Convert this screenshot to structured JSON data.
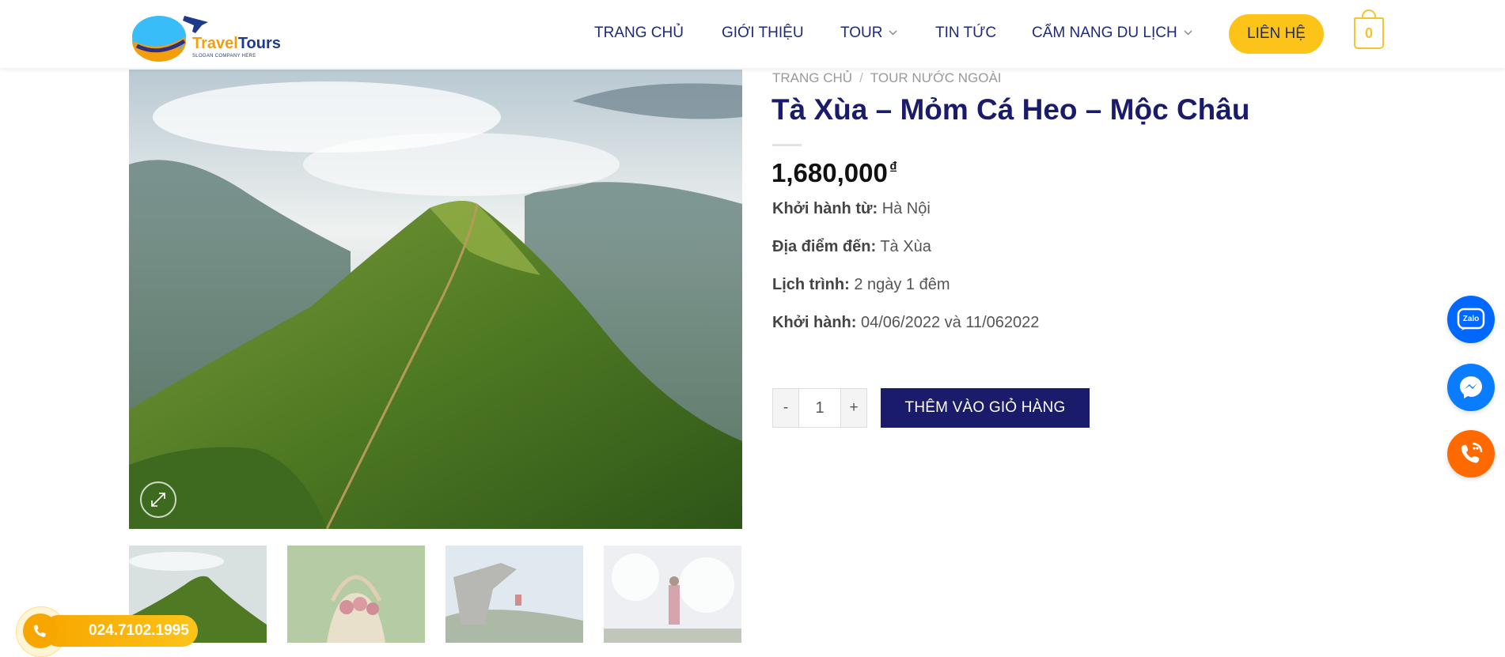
{
  "logo": {
    "name_part1": "Travel",
    "name_part2": "Tours",
    "slogan": "SLOGAN COMPANY HERE"
  },
  "nav": {
    "items": [
      {
        "label": "TRANG CHỦ",
        "dropdown": false
      },
      {
        "label": "GIỚI THIỆU",
        "dropdown": false
      },
      {
        "label": "TOUR",
        "dropdown": true
      },
      {
        "label": "TIN TỨC",
        "dropdown": false
      },
      {
        "label": "CẨM NANG DU LỊCH",
        "dropdown": true
      }
    ],
    "contact_label": "LIÊN HỆ",
    "cart_count": "0"
  },
  "breadcrumb": {
    "home": "TRANG CHỦ",
    "separator": "/",
    "category": "TOUR NƯỚC NGOÀI"
  },
  "product": {
    "title": "Tà Xùa – Mỏm Cá Heo – Mộc Châu",
    "price": "1,680,000",
    "currency": "₫",
    "details": [
      {
        "label": "Khởi hành từ:",
        "value": "Hà Nội"
      },
      {
        "label": "Địa điểm đến:",
        "value": "Tà Xùa"
      },
      {
        "label": "Lịch trình:",
        "value": "2 ngày 1 đêm"
      },
      {
        "label": "Khởi hành:",
        "value": "04/06/2022 và 11/062022"
      }
    ],
    "quantity": "1",
    "qty_minus": "-",
    "qty_plus": "+",
    "add_to_cart_label": "THÊM VÀO GIỎ HÀNG"
  },
  "floating": {
    "zalo_label": "Zalo",
    "hotline": "024.7102.1995"
  },
  "icons": {
    "zoom": "expand-icon",
    "zalo": "zalo-icon",
    "messenger": "messenger-icon",
    "phone": "phone-icon",
    "cart": "cart-icon",
    "chevron": "chevron-down-icon"
  },
  "colors": {
    "primary": "#1b1b6b",
    "accent": "#fcc419",
    "zalo": "#0068ff",
    "messenger": "#0a7cff",
    "phone": "#ff6a00"
  }
}
